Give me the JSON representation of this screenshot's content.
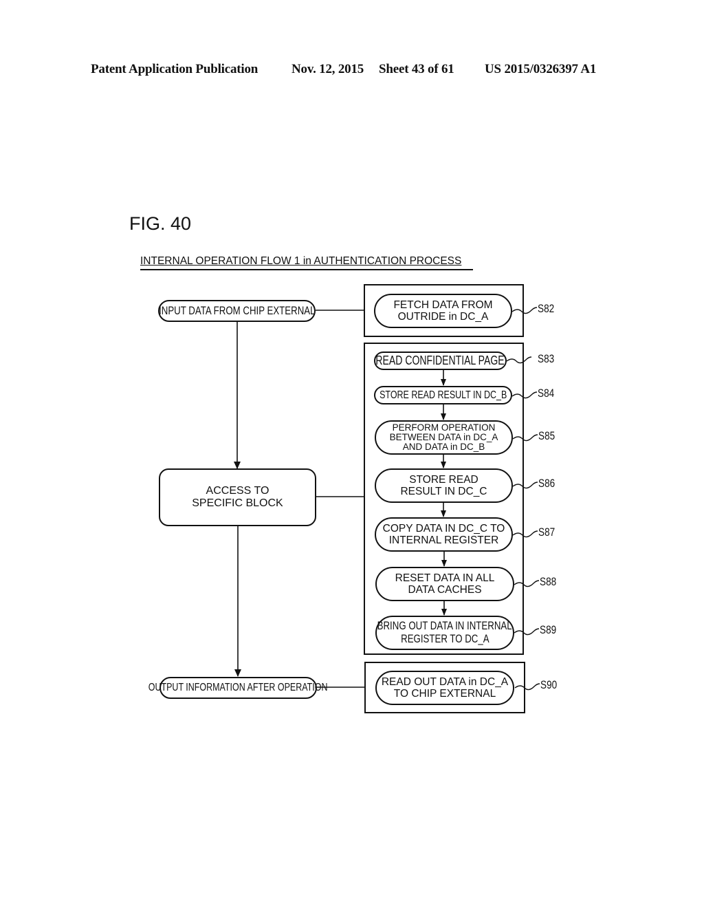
{
  "header": {
    "publication": "Patent Application Publication",
    "date": "Nov. 12, 2015",
    "sheet": "Sheet 43 of 61",
    "patent_no": "US 2015/0326397 A1"
  },
  "figure": {
    "label": "FIG. 40",
    "title": "INTERNAL OPERATION FLOW 1 in AUTHENTICATION PROCESS"
  },
  "left_flow": {
    "input": "INPUT DATA FROM CHIP EXTERNAL",
    "access_line1": "ACCESS TO",
    "access_line2": "SPECIFIC BLOCK",
    "output": "OUTPUT INFORMATION AFTER OPERATION"
  },
  "steps": [
    {
      "id": "S82",
      "line1": "FETCH DATA FROM",
      "line2": "OUTRIDE in DC_A",
      "line3": ""
    },
    {
      "id": "S83",
      "line1": "READ CONFIDENTIAL PAGE",
      "line2": "",
      "line3": ""
    },
    {
      "id": "S84",
      "line1": "STORE READ RESULT IN DC_B",
      "line2": "",
      "line3": ""
    },
    {
      "id": "S85",
      "line1": "PERFORM OPERATION",
      "line2": "BETWEEN DATA in DC_A",
      "line3": "AND DATA in DC_B"
    },
    {
      "id": "S86",
      "line1": "STORE READ",
      "line2": "RESULT IN DC_C",
      "line3": ""
    },
    {
      "id": "S87",
      "line1": "COPY DATA IN DC_C TO",
      "line2": "INTERNAL REGISTER",
      "line3": ""
    },
    {
      "id": "S88",
      "line1": "RESET DATA IN ALL",
      "line2": "DATA CACHES",
      "line3": ""
    },
    {
      "id": "S89",
      "line1": "BRING OUT DATA IN INTERNAL",
      "line2": "REGISTER TO DC_A",
      "line3": ""
    },
    {
      "id": "S90",
      "line1": "READ OUT DATA in DC_A",
      "line2": "TO CHIP EXTERNAL",
      "line3": ""
    }
  ]
}
